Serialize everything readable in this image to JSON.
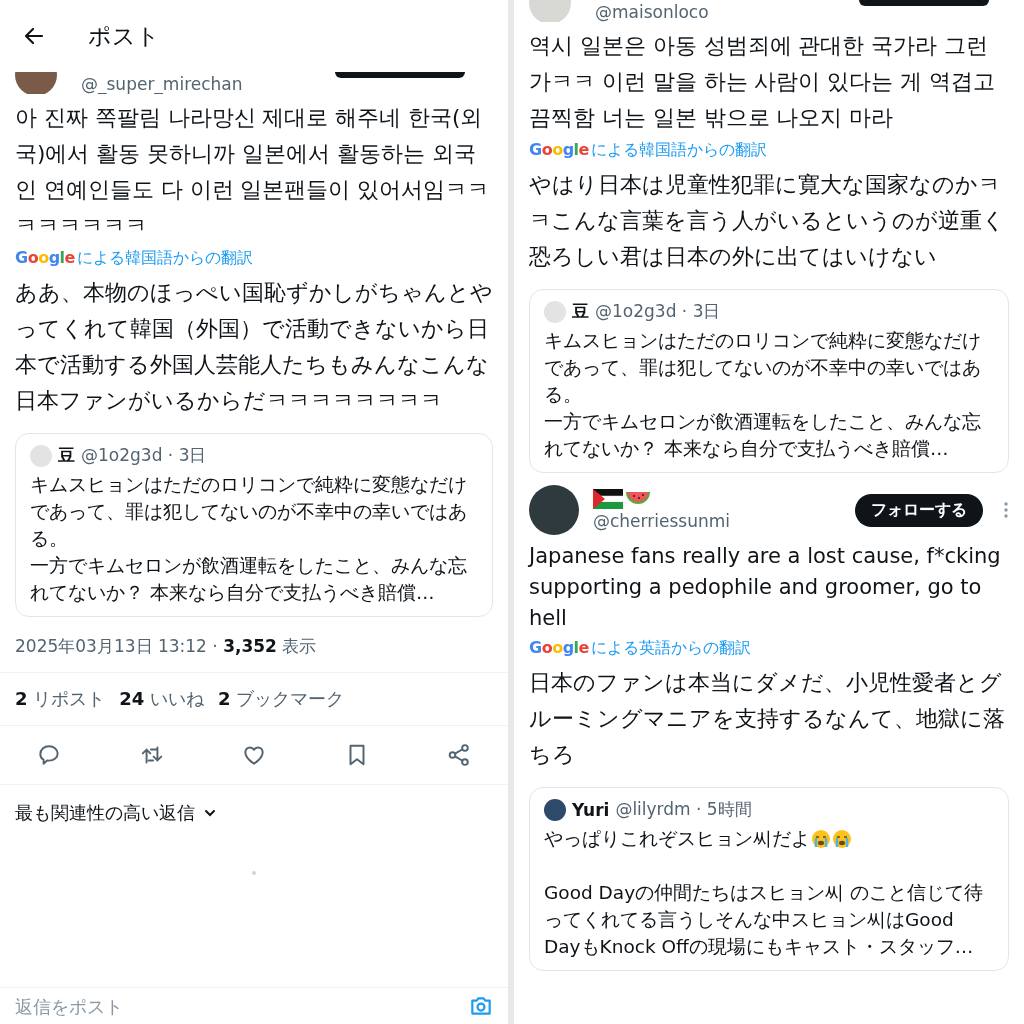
{
  "left": {
    "header": {
      "title": "ポスト"
    },
    "post": {
      "kind": "partial",
      "avatar": {
        "kind": "brown"
      },
      "handle": "@_super_mirechan",
      "text": "아 진짜 쪽팔림 나라망신 제대로 해주네 한국(외국)에서 활동 못하니까 일본에서 활동하는 외국인 연예인들도 다 이런 일본팬들이 있어서임ㅋㅋㅋㅋㅋㅋㅋㅋ",
      "translation_brand": "Google",
      "translation_source": "による韓国語からの翻訳",
      "translation": "ああ、本物のほっぺい国恥ずかしがちゃんとやってくれて韓国（外国）で活動できないから日本で活動する外国人芸能人たちもみんなこんな日本ファンがいるからだㅋㅋㅋㅋㅋㅋㅋㅋ",
      "quote": {
        "name": "豆",
        "meta": "@1o2g3d · 3日",
        "avatar": {
          "kind": "sketch"
        },
        "paragraphs": [
          {
            "lines": [
              "キムスヒョンはただのロリコンで純粋に変態なだけであって、罪は犯してないのが不幸中の幸いではある。",
              "一方でキムセロンが飲酒運転をしたこと、みんな忘れてないか？ 本来なら自分で支払うべき賠償…"
            ]
          }
        ]
      },
      "timestamp_line": "2025年03月13日 13:12 · **3,352** 表示"
    },
    "stats": [
      "**2** リポスト",
      "**24** いいね",
      "**2** ブックマーク"
    ],
    "actions": [
      {
        "kind": "reply"
      },
      {
        "kind": "repost"
      },
      {
        "kind": "like"
      },
      {
        "kind": "bookmark"
      },
      {
        "kind": "share"
      }
    ],
    "sort_label": "最も関連性の高い返信",
    "reply_field": {
      "placeholder": "返信をポスト"
    }
  },
  "right": {
    "posts": [
      {
        "kind": "partial",
        "avatar": {
          "kind": "light"
        },
        "handle": "@maisonloco",
        "text": "역시 일본은 아동 성범죄에 관대한 국가라 그런가ㅋㅋ 이런 말을 하는 사람이 있다는 게 역겹고 끔찍함 너는 일본 밖으로 나오지 마라",
        "translation_brand": "Google",
        "translation_source": "による韓国語からの翻訳",
        "translation": "やはり日本は児童性犯罪に寛大な国家なのかㅋㅋこんな言葉を言う人がいるというのが逆重く恐ろしい君は日本の外に出てはいけない",
        "quote": {
          "name": "豆",
          "meta": "@1o2g3d · 3日",
          "avatar": {
            "kind": "sketch"
          },
          "paragraphs": [
            {
              "lines": [
                "キムスヒョンはただのロリコンで純粋に変態なだけであって、罪は犯してないのが不幸中の幸いではある。",
                "一方でキムセロンが飲酒運転をしたこと、みんな忘れてないか？ 本来なら自分で支払うべき賠償…"
              ]
            }
          ]
        }
      },
      {
        "kind": "full",
        "avatar": {
          "kind": "photo"
        },
        "name_icons": [
          {
            "kind": "flag"
          },
          {
            "kind": "watermelon"
          }
        ],
        "handle": "@cherriessunmi",
        "follow_label": "フォローする",
        "text": "Japanese fans really are a lost cause, f*cking supporting a pedophile and groomer, go to hell",
        "translation_brand": "Google",
        "translation_source": "による英語からの翻訳",
        "translation": "日本のファンは本当にダメだ、小児性愛者とグルーミングマニアを支持するなんて、地獄に落ちろ",
        "quote": {
          "name": "Yuri",
          "meta": "@lilyrdm · 5時間",
          "avatar": {
            "kind": "dark"
          },
          "paragraphs": [
            {
              "lines": [
                "やっぱりこれぞスヒョン씨だよ"
              ],
              "icons": [
                {
                  "kind": "crying"
                },
                {
                  "kind": "crying"
                }
              ]
            },
            {
              "lines": [
                "Good Dayの仲間たちはスヒョン씨 のこと信じて待ってくれてる言うしそんな中スヒョン씨はGood DayもKnock Offの現場にもキャスト・スタッフ…"
              ]
            }
          ]
        }
      }
    ]
  }
}
